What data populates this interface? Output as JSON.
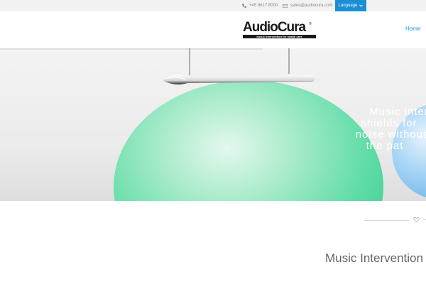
{
  "topbar": {
    "phone": "+45 8617 8000",
    "email": "sales@audiocura.com",
    "language_label": "Language",
    "icons": {
      "phone": "phone-icon",
      "email": "envelope-icon",
      "dropdown": "chevron-down-icon"
    }
  },
  "header": {
    "logo_text": "AudioCura",
    "logo_registered": "®",
    "logo_tagline": "music intervention for health care",
    "nav": {
      "home_label": "Home"
    }
  },
  "hero": {
    "lines": [
      "Music inter",
      "shields for",
      "noise without",
      "the pat"
    ]
  },
  "section": {
    "title": "Music Intervention",
    "divider_icon": "heart-outline-icon"
  },
  "colors": {
    "accent": "#1a8fd6",
    "topbar_bg": "#f2f2f2",
    "sphere_green": "#5fdca7",
    "sphere_blue": "#7fbfee",
    "section_title": "#666666"
  }
}
